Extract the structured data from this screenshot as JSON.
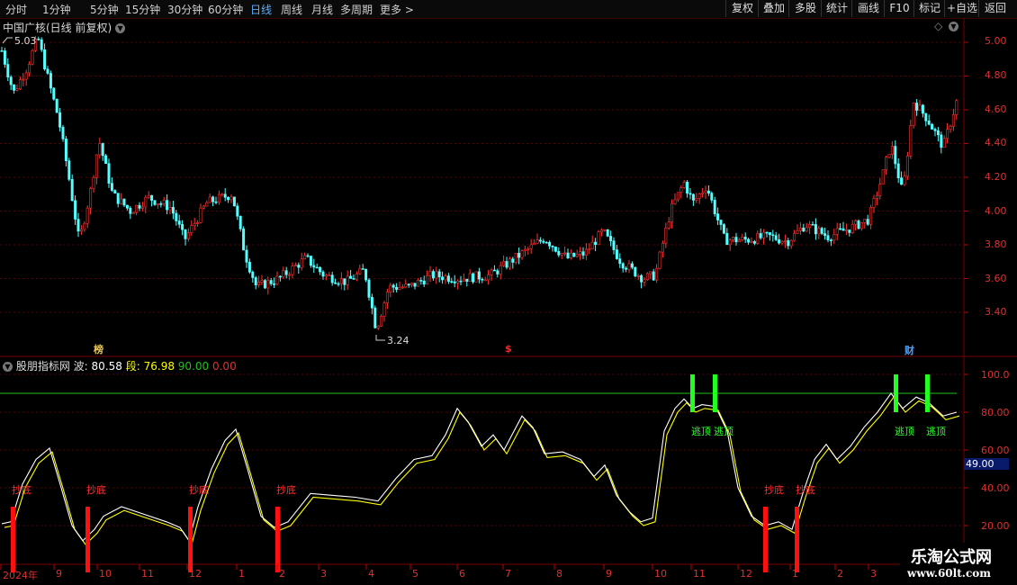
{
  "toolbar": {
    "timeframes": [
      "分时",
      "1分钟",
      "5分钟",
      "15分钟",
      "30分钟",
      "60分钟",
      "日线",
      "周线",
      "月线",
      "多周期",
      "更多"
    ],
    "active_timeframe": "日线",
    "more_arrow": ">",
    "buttons": [
      "复权",
      "叠加",
      "多股",
      "统计",
      "画线",
      "F10",
      "标记",
      "+自选",
      "返回"
    ]
  },
  "main_chart": {
    "title": "中国广核(日线 前复权)",
    "high_label": "5.03",
    "low_label": "3.24",
    "price_axis": [
      "5.00",
      "4.80",
      "4.60",
      "4.40",
      "4.20",
      "4.00",
      "3.80",
      "3.60",
      "3.40"
    ],
    "markers": [
      {
        "text": "榜",
        "color": "#e8c85a"
      },
      {
        "text": "$",
        "color": "#e83030"
      },
      {
        "text": "财",
        "color": "#4aa0ff"
      }
    ]
  },
  "indicator": {
    "name": "股朋指标网",
    "wave_label": "波:",
    "wave_value": "80.58",
    "seg_label": "段:",
    "seg_value": "76.98",
    "line_value": "90.00",
    "zero_value": "0.00",
    "axis": [
      "100.0",
      "80.00",
      "60.00",
      "40.00",
      "20.00"
    ],
    "current_tag": "49.00",
    "buy_label": "抄底",
    "sell_label": "逃顶"
  },
  "time_axis": [
    "2024年",
    "9",
    "10",
    "11",
    "12",
    "1",
    "2",
    "3",
    "4",
    "5",
    "6",
    "7",
    "8",
    "9",
    "10",
    "11",
    "12",
    "1",
    "2",
    "3"
  ],
  "watermark": {
    "name": "乐淘公式网",
    "url": "www.60lt.com"
  },
  "colors": {
    "up": "#ff3232",
    "down": "#54ffff",
    "wave": "#ffffff",
    "seg": "#ffff00",
    "buy": "#ff1010",
    "sell": "#20ff20",
    "level90": "#20c020"
  }
}
